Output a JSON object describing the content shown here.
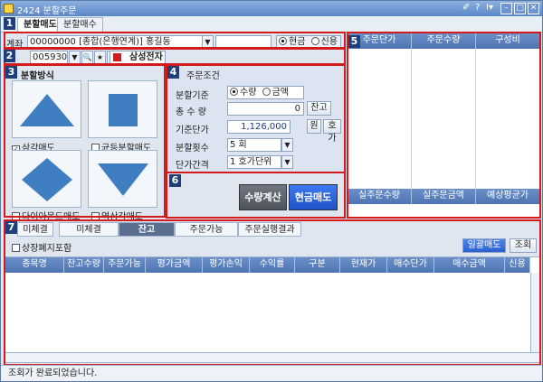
{
  "window": {
    "title": "2424 분할주문",
    "titlebar_glyphs": [
      "✐",
      "?",
      "I▾"
    ]
  },
  "top_tabs": [
    {
      "label": "분할매도"
    },
    {
      "label": "분할매수"
    }
  ],
  "sections": [
    "1",
    "2",
    "3",
    "4",
    "5",
    "6",
    "7"
  ],
  "account": {
    "label": "계좌",
    "value": "00000000 [종합(은행연계)] 홍길동",
    "password": "",
    "payment_options": [
      "현금",
      "신용"
    ],
    "selected": "현금"
  },
  "stock": {
    "code": "005930",
    "name": "삼성전자"
  },
  "split_method": {
    "title": "분할방식",
    "options": [
      {
        "label": "삼각매도",
        "checked": true
      },
      {
        "label": "균등분할매도",
        "checked": false
      },
      {
        "label": "다이아몬드매도",
        "checked": false
      },
      {
        "label": "역삼각매도",
        "checked": false
      }
    ]
  },
  "order_conditions": {
    "title": "주문조건",
    "basis_label": "분할기준",
    "basis_options": [
      "수량",
      "금액"
    ],
    "basis_selected": "수량",
    "qty_label": "총 수 량",
    "qty_value": "0",
    "balance_btn": "잔고",
    "price_label": "기준단가",
    "price_value": "1,126,000",
    "won_btn": "원",
    "hoga_btn": "호가",
    "count_label": "분할횟수",
    "count_value": "5 회",
    "interval_label": "단가간격",
    "interval_value": "1 호가단위"
  },
  "actions": {
    "calc": "수량계산",
    "sell": "현금매도"
  },
  "preview": {
    "headers": [
      "주문단가",
      "주문수량",
      "구성비"
    ],
    "footer_headers": [
      "실주문수량",
      "실주문금액",
      "예상평균가"
    ]
  },
  "bottom": {
    "tabs": [
      "미체결",
      "미체결",
      "잔고",
      "주문가능",
      "주문실행결과"
    ],
    "active_tab": 2,
    "delisted_check": "상장폐지포함",
    "bulk_sell_btn": "일괄매도",
    "query_btn": "조회",
    "headers": [
      "종목명",
      "잔고수량",
      "주문가능",
      "평가금액",
      "평가손익",
      "수익률",
      "구분",
      "현재가",
      "매수단가",
      "매수금액",
      "신용"
    ]
  },
  "status_text": "조회가 완료되었습니다.",
  "colors": {
    "red": "#d31b1b",
    "sell_blue": "#2a5fd6",
    "header_blue": "#5a80bf"
  }
}
